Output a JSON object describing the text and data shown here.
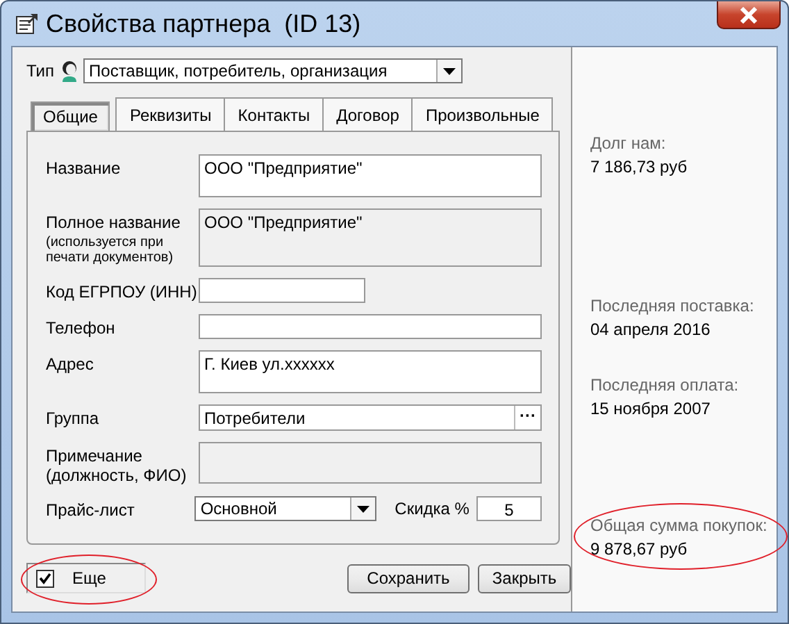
{
  "window": {
    "title": "Свойства партнера  (ID 13)"
  },
  "type_field": {
    "label": "Тип",
    "value": "Поставщик, потребитель, организация"
  },
  "tabs": [
    {
      "label": "Общие",
      "selected": true
    },
    {
      "label": "Реквизиты",
      "selected": false
    },
    {
      "label": "Контакты",
      "selected": false
    },
    {
      "label": "Договор",
      "selected": false
    },
    {
      "label": "Произвольные",
      "selected": false
    }
  ],
  "fields": [
    {
      "kind": "multiline",
      "label": "Название",
      "value": "ООО \"Предприятие\""
    },
    {
      "kind": "readonly",
      "label": "Полное название",
      "note": "(используется при печати документов)",
      "value": "ООО \"Предприятие\""
    },
    {
      "kind": "short",
      "label": "Код ЕГРПОУ (ИНН)"
    },
    {
      "kind": "text",
      "label": "Телефон"
    },
    {
      "kind": "multiline",
      "label": "Адрес",
      "value": "Г. Киев ул.xxxxxx"
    },
    {
      "kind": "picker",
      "label": "Группа",
      "value": "Потребители",
      "button": "···"
    },
    {
      "kind": "readonly",
      "label": "Примечание (должность, ФИО)"
    },
    {
      "kind": "price",
      "label": "Прайс-лист",
      "value": "Основной",
      "discount_label": "Скидка %",
      "discount": "5"
    }
  ],
  "more": {
    "label": "Еще",
    "checked": true,
    "highlighted": true
  },
  "buttons": [
    "Сохранить",
    "Закрыть"
  ],
  "stats": [
    {
      "label": "Долг нам:",
      "value": "7 186,73 руб",
      "highlighted": false
    },
    {
      "label": "Последняя поставка:",
      "value": "04 апреля 2016",
      "highlighted": false
    },
    {
      "label": "Последняя оплата:",
      "value": "15 ноября 2007",
      "highlighted": false
    },
    {
      "label": "Общая сумма покупок:",
      "value": "9 878,67 руб",
      "highlighted": true
    }
  ]
}
